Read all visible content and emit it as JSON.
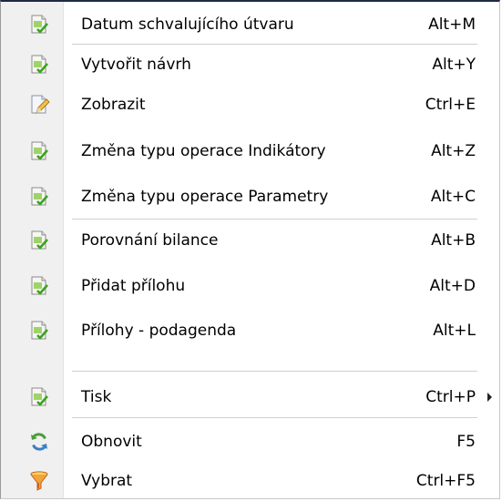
{
  "menu": {
    "items": [
      {
        "label": "Datum schvalujícího útvaru",
        "shortcut": "Alt+M",
        "icon": "document-check-icon"
      },
      {
        "label": "Vytvořit návrh",
        "shortcut": "Alt+Y",
        "icon": "document-check-icon"
      },
      {
        "label": "Zobrazit",
        "shortcut": "Ctrl+E",
        "icon": "document-edit-icon"
      },
      {
        "label": "Změna typu operace Indikátory",
        "shortcut": "Alt+Z",
        "icon": "document-check-icon"
      },
      {
        "label": "Změna typu operace Parametry",
        "shortcut": "Alt+C",
        "icon": "document-check-icon"
      },
      {
        "label": "Porovnání bilance",
        "shortcut": "Alt+B",
        "icon": "document-check-icon"
      },
      {
        "label": "Přidat přílohu",
        "shortcut": "Alt+D",
        "icon": "document-check-icon"
      },
      {
        "label": "Přílohy - podagenda",
        "shortcut": "Alt+L",
        "icon": "document-check-icon"
      },
      {
        "label": "Tisk",
        "shortcut": "Ctrl+P",
        "icon": "document-check-icon",
        "submenu": true
      },
      {
        "label": "Obnovit",
        "shortcut": "F5",
        "icon": "refresh-icon"
      },
      {
        "label": "Vybrat",
        "shortcut": "Ctrl+F5",
        "icon": "filter-icon"
      }
    ]
  },
  "colors": {
    "gutter": "#f0f0f0",
    "check_green": "#3aa21f",
    "separator": "#d0d0d0"
  }
}
